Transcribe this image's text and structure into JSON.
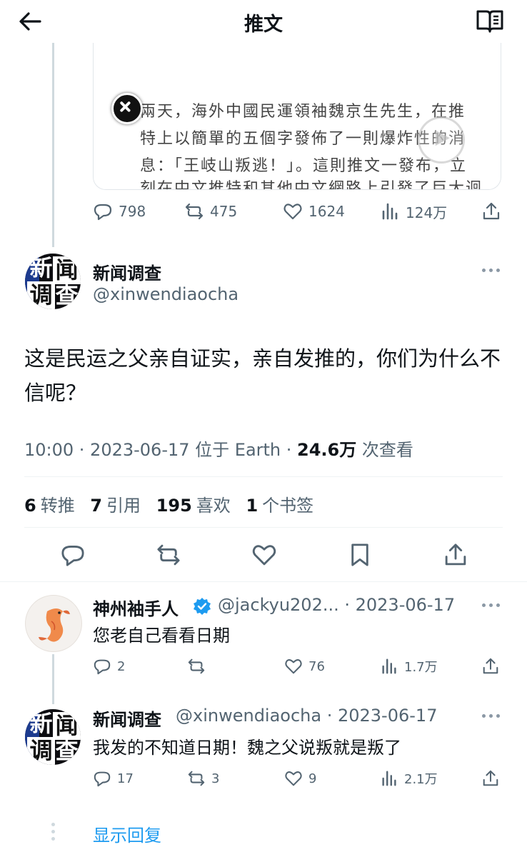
{
  "header": {
    "title": "推文"
  },
  "quoted_card": {
    "lines": [
      "兩天，海外中國民運領袖魏京生先生，在推",
      "特上以簡單的五個字發佈了一則爆炸性的消",
      "息：「王岐山叛逃！」。這則推文一發布，立",
      "刻在中文推特和其他中文網路上引發了巨大迴"
    ]
  },
  "parent_actions": {
    "replies": "798",
    "retweets": "475",
    "likes": "1624",
    "views": "124万"
  },
  "main_tweet": {
    "avatar_chars": [
      "新",
      "闻",
      "调",
      "查"
    ],
    "name": "新闻调查",
    "handle": "@xinwendiaocha",
    "text": "这是民运之父亲自证实，亲自发推的，你们为什么不信呢？",
    "time": "10:00 · 2023-06-17 位于 Earth · ",
    "views_count": "24.6万",
    "views_label": " 次查看",
    "stats": {
      "retweets_num": "6",
      "retweets_label": "转推",
      "quotes_num": "7",
      "quotes_label": "引用",
      "likes_num": "195",
      "likes_label": "喜欢",
      "bookmarks_num": "1",
      "bookmarks_label": "个书签"
    }
  },
  "replies": [
    {
      "name": "神州袖手人",
      "handle": "@jackyu202... · 2023-06-17",
      "text": "您老自己看看日期",
      "replies": "2",
      "retweets": "",
      "likes": "76",
      "views": "1.7万"
    },
    {
      "name": "新闻调查",
      "handle": "@xinwendiaocha · 2023-06-17",
      "text": "我发的不知道日期！魏之父说叛就是叛了",
      "replies": "17",
      "retweets": "3",
      "likes": "9",
      "views": "2.1万"
    }
  ],
  "show_replies": "显示回复",
  "colors": {
    "accent": "#1d9bf0",
    "muted": "#536471",
    "text": "#0f1419",
    "verified": "#1d9bf0"
  }
}
